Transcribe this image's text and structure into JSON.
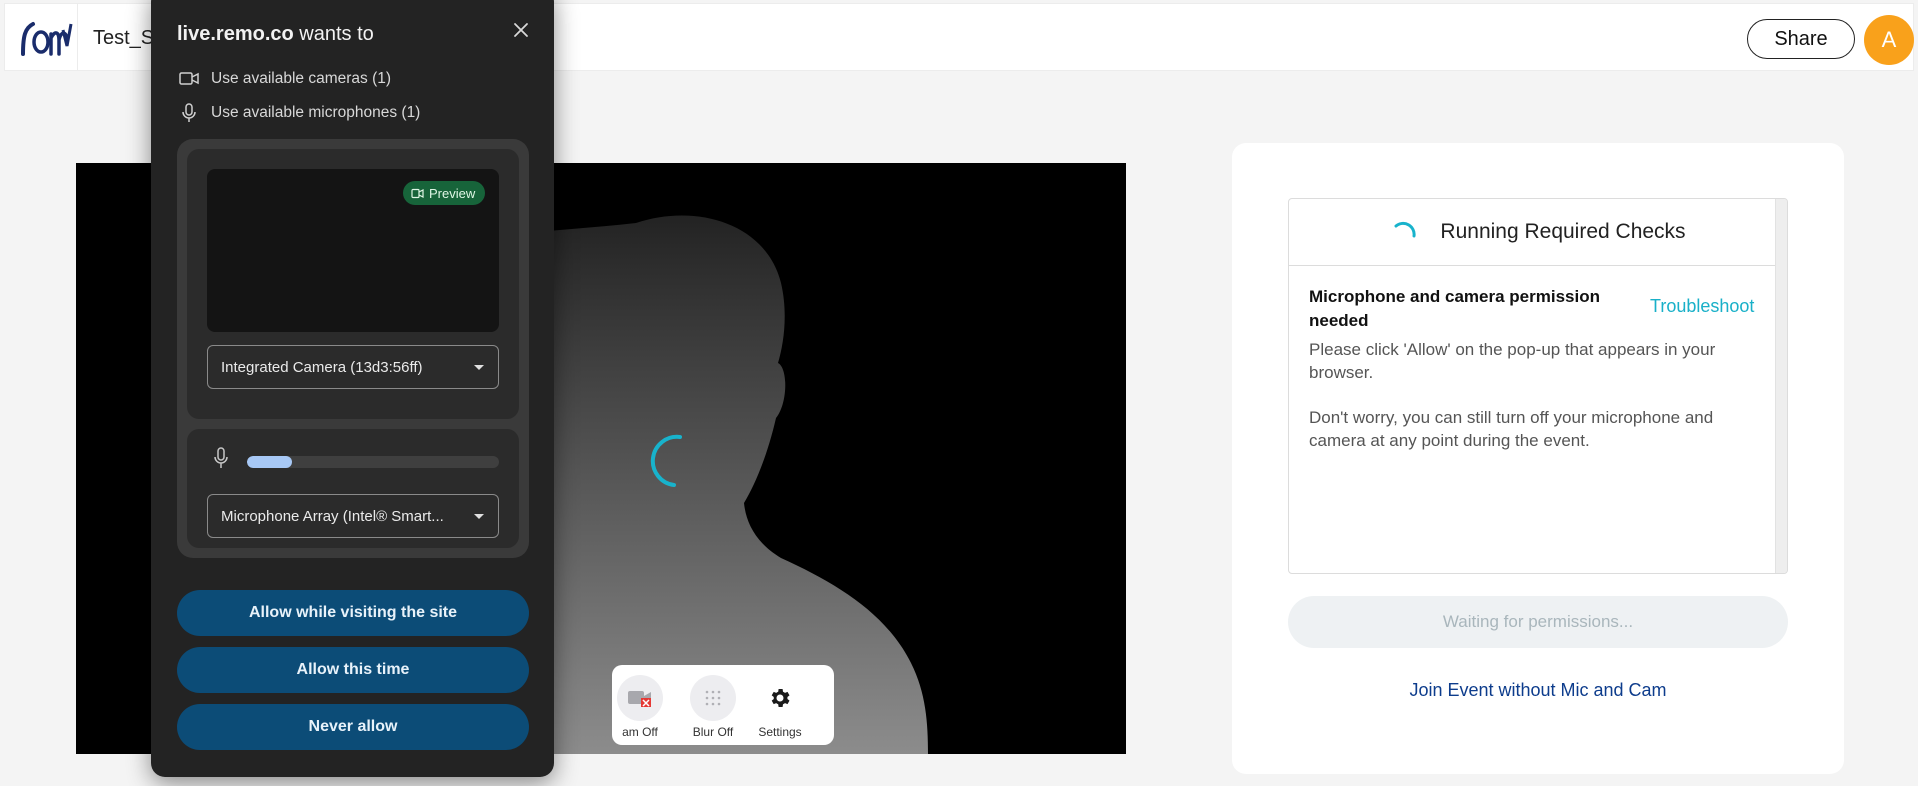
{
  "header": {
    "event_name": "Test_S",
    "share_label": "Share",
    "avatar_initial": "A"
  },
  "video": {
    "controls": [
      {
        "label": "am Off",
        "icon": "camera-off-icon"
      },
      {
        "label": "Blur Off",
        "icon": "blur-icon"
      },
      {
        "label": "Settings",
        "icon": "gear-icon"
      }
    ]
  },
  "checks": {
    "title": "Running Required Checks",
    "permission_title": "Microphone and camera permission needed",
    "troubleshoot": "Troubleshoot",
    "message_1": "Please click 'Allow' on the pop-up that appears in your browser.",
    "message_2": "Don't worry, you can still turn off your microphone and camera at any point during the event.",
    "waiting_label": "Waiting for permissions...",
    "join_label": "Join Event without Mic and Cam"
  },
  "popup": {
    "site": "live.remo.co",
    "wants_to": "wants to",
    "perm_camera": "Use available cameras (1)",
    "perm_mic": "Use available microphones (1)",
    "preview_label": "Preview",
    "camera_select": "Integrated Camera (13d3:56ff)",
    "mic_select": "Microphone Array (Intel® Smart...",
    "mic_level": 0.18,
    "btn_allow_site": "Allow while visiting the site",
    "btn_allow_once": "Allow this time",
    "btn_never": "Never allow"
  },
  "colors": {
    "accent_teal": "#19b0c8",
    "popup_button": "#0c4c77",
    "avatar": "#f9a11b",
    "link_blue": "#0d3c8c"
  }
}
